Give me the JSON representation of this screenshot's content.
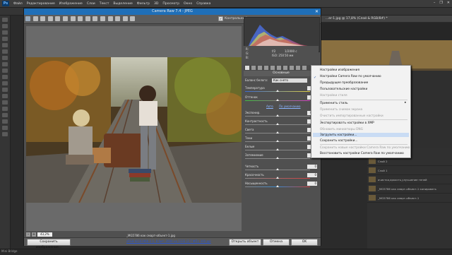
{
  "photoshop": {
    "logo": "Ps",
    "menu": [
      "Файл",
      "Редактирование",
      "Изображение",
      "Слои",
      "Текст",
      "Выделение",
      "Фильтр",
      "3D",
      "Просмотр",
      "Окно",
      "Справка"
    ],
    "window_controls": [
      "–",
      "❐",
      "✕"
    ],
    "doc_tab": "...er-1.jpg @ 17,8% (Слой & RGB/8#) *",
    "layers": [
      {
        "name": "Слой 2"
      },
      {
        "name": "Слой 1"
      },
      {
        "name": "очистка,яркость,улучшение теней"
      },
      {
        "name": "_MG5786 как смарт-объект-1 копировать"
      },
      {
        "name": "_MG5786 как смарт-объект-1"
      }
    ],
    "status": "Mini Bridge"
  },
  "camera_raw": {
    "title": "Camera Raw 7.4 - JPEG",
    "close": "✕",
    "preview_label": "Контрольный просмотр",
    "preview_checked": "✓",
    "histogram_readout": [
      "R:",
      "G:",
      "B:",
      "f/2",
      "1/2000 с",
      "ISO: 250",
      "50 мм"
    ],
    "basic_tab": "Основные",
    "white_balance": {
      "label": "Баланс белого:",
      "value": "Как снято"
    },
    "controls": [
      {
        "label": "Температура",
        "value": "0"
      },
      {
        "label": "Оттенок",
        "value": "0"
      },
      {
        "label": "Экспонир.",
        "value": "0,00"
      },
      {
        "label": "Контрастность",
        "value": "0"
      },
      {
        "label": "Света",
        "value": "0"
      },
      {
        "label": "Тени",
        "value": "0"
      },
      {
        "label": "Белые",
        "value": "0"
      },
      {
        "label": "Затемнение",
        "value": "0"
      },
      {
        "label": "Четкость",
        "value": "0"
      },
      {
        "label": "Красочность",
        "value": "0"
      },
      {
        "label": "Насыщенность",
        "value": "0"
      }
    ],
    "auto_link": "Авто",
    "default_link": "По умолчанию",
    "zoom": "43,2%",
    "filename": "_MG5786 как смарт-объект-1.jpg",
    "info_link": "sRGB IEC61966-2.1; 8 бит; 2000 на 1333 (2,7 МП); 300 ppi",
    "buttons": {
      "save": "Сохранить изображение...",
      "open": "Открыть объект",
      "cancel": "Отмена",
      "ok": "OK"
    }
  },
  "context_menu": {
    "items": [
      {
        "label": "Настройки изображения",
        "disabled": false,
        "checked": false
      },
      {
        "label": "Настройки Camera Raw по умолчанию",
        "disabled": false,
        "checked": true
      },
      {
        "label": "Предыдущее преобразование",
        "disabled": false,
        "checked": false
      },
      {
        "label": "Пользовательские настройки",
        "disabled": false,
        "checked": false
      },
      {
        "label": "Настройки стиля",
        "disabled": true,
        "checked": false
      },
      {
        "label": "Применить стиль",
        "disabled": false,
        "checked": false,
        "submenu": true
      },
      {
        "label": "Применить снимок экрана",
        "disabled": true,
        "checked": false
      },
      {
        "label": "Очистить импортированные настройки",
        "disabled": true,
        "checked": false
      },
      {
        "label": "Экспортировать настройки в XMP",
        "disabled": false,
        "checked": false
      },
      {
        "label": "Обновить миниатюры DNG",
        "disabled": true,
        "checked": false
      },
      {
        "label": "Загрузить настройки...",
        "disabled": false,
        "checked": false,
        "highlighted": true
      },
      {
        "label": "Сохранить настройки...",
        "disabled": false,
        "checked": false
      },
      {
        "label": "Сохранить новые настройки Camera Raw по умолчанию",
        "disabled": true,
        "checked": false
      },
      {
        "label": "Восстановить настройки Camera Raw по умолчанию",
        "disabled": false,
        "checked": false
      }
    ]
  },
  "colors": {
    "ps_bg": "#2b2b2b",
    "cr_bg": "#505050",
    "cr_titlebar": "#1f6fb8",
    "menu_bg": "#f2f2f2",
    "menu_highlight": "#c9dcf4"
  }
}
